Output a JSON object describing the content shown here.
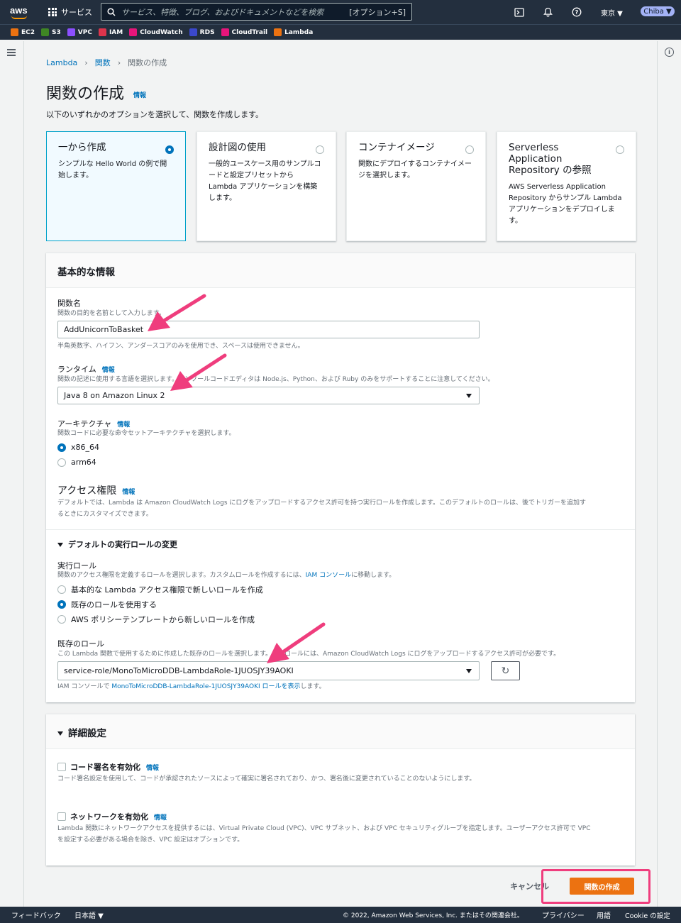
{
  "topnav": {
    "logo": "aws",
    "services_label": "サービス",
    "search_placeholder": "サービス、特徴、ブログ、およびドキュメントなどを検索",
    "search_shortcut": "[オプション+S]",
    "region": "東京 ▼",
    "user": "Chiba ▼"
  },
  "favorites": [
    {
      "label": "EC2",
      "color": "#ec7211"
    },
    {
      "label": "S3",
      "color": "#3f8624"
    },
    {
      "label": "VPC",
      "color": "#8c4fff"
    },
    {
      "label": "IAM",
      "color": "#dd344c"
    },
    {
      "label": "CloudWatch",
      "color": "#e7157b"
    },
    {
      "label": "RDS",
      "color": "#3b48cc"
    },
    {
      "label": "CloudTrail",
      "color": "#e7157b"
    },
    {
      "label": "Lambda",
      "color": "#ec7211"
    }
  ],
  "breadcrumb": {
    "item1": "Lambda",
    "item2": "関数",
    "current": "関数の作成"
  },
  "page": {
    "title": "関数の作成",
    "title_info": "情報",
    "description": "以下のいずれかのオプションを選択して、関数を作成します。"
  },
  "options": [
    {
      "title": "一から作成",
      "desc": "シンプルな Hello World の例で開始します。",
      "selected": true
    },
    {
      "title": "設計図の使用",
      "desc": "一般的ユースケース用のサンプルコードと設定プリセットから Lambda アプリケーションを構築します。",
      "selected": false
    },
    {
      "title": "コンテナイメージ",
      "desc": "関数にデプロイするコンテナイメージを選択します。",
      "selected": false
    },
    {
      "title": "Serverless Application Repository の参照",
      "desc": "AWS Serverless Application Repository からサンプル Lambda アプリケーションをデプロイします。",
      "selected": false
    }
  ],
  "basic": {
    "heading": "基本的な情報",
    "function_name_label": "関数名",
    "function_name_desc": "関数の目的を名前として入力します。",
    "function_name_value": "AddUnicornToBasket",
    "function_name_hint": "半角英数字、ハイフン、アンダースコアのみを使用でき、スペースは使用できません。",
    "runtime_label": "ランタイム",
    "runtime_info": "情報",
    "runtime_desc": "関数の記述に使用する言語を選択します。コンソールコードエディタは Node.js、Python、および Ruby のみをサポートすることに注意してください。",
    "runtime_value": "Java 8 on Amazon Linux 2",
    "arch_label": "アーキテクチャ",
    "arch_info": "情報",
    "arch_desc": "関数コードに必要な命令セットアーキテクチャを選択します。",
    "arch_options": [
      "x86_64",
      "arm64"
    ],
    "perm_label": "アクセス権限",
    "perm_info": "情報",
    "perm_desc_1": "デフォルトでは、Lambda は Amazon CloudWatch Logs にログをアップロードするアクセス許可を持つ実行ロールを作成します。このデフォルトのロールは、後でトリガーを追加す",
    "perm_desc_2": "るときにカスタマイズできます。",
    "role_toggle": "デフォルトの実行ロールの変更",
    "exec_role_label": "実行ロール",
    "exec_role_desc_prefix": "関数のアクセス権限を定義するロールを選択します。カスタムロールを作成するには、",
    "exec_role_desc_link": "IAM コンソール",
    "exec_role_desc_suffix": "に移動します。",
    "role_options": [
      "基本的な Lambda アクセス権限で新しいロールを作成",
      "既存のロールを使用する",
      "AWS ポリシーテンプレートから新しいロールを作成"
    ],
    "existing_role_label": "既存のロール",
    "existing_role_desc": "この Lambda 関数で使用するために作成した既存のロールを選択します。このロールには、Amazon CloudWatch Logs にログをアップロードするアクセス許可が必要です。",
    "existing_role_value": "service-role/MonoToMicroDDB-LambdaRole-1JUOSJY39AOKI",
    "iam_note_prefix": "IAM コンソールで ",
    "iam_note_link": "MonoToMicroDDB-LambdaRole-1JUOSJY39AOKI ロールを表示",
    "iam_note_suffix": "します。"
  },
  "advanced": {
    "heading": "詳細設定",
    "code_sign_label": "コード署名を有効化",
    "code_sign_info": "情報",
    "code_sign_desc": "コード署名設定を使用して、コードが承認されたソースによって確実に署名されており、かつ、署名後に変更されていることのないようにします。",
    "network_label": "ネットワークを有効化",
    "network_info": "情報",
    "network_desc_1": "Lambda 関数にネットワークアクセスを提供するには、Virtual Private Cloud (VPC)、VPC サブネット、および VPC セキュリティグループを指定します。ユーザーアクセス許可で VPC",
    "network_desc_2": "を設定する必要がある場合を除き、VPC 設定はオプションです。"
  },
  "actions": {
    "cancel": "キャンセル",
    "create": "関数の作成"
  },
  "footer": {
    "feedback": "フィードバック",
    "language": "日本語 ▼",
    "copyright": "© 2022, Amazon Web Services, Inc. またはその関連会社。",
    "privacy": "プライバシー",
    "terms": "用語",
    "cookie": "Cookie の設定"
  },
  "colors": {
    "accent": "#0073bb",
    "primary_button": "#ec7211",
    "annotation": "#ef3d7d",
    "nav": "#232f3e"
  }
}
